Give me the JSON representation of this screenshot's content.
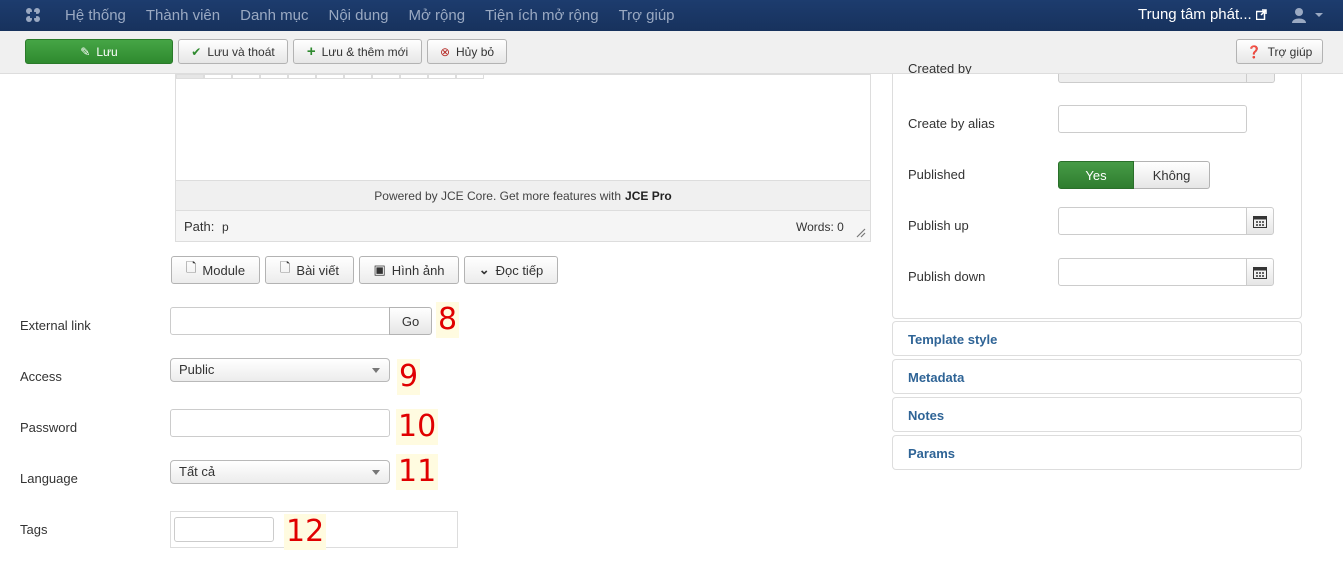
{
  "navbar": {
    "menu": [
      "Hệ thống",
      "Thành viên",
      "Danh mục",
      "Nội dung",
      "Mở rộng",
      "Tiện ích mở rộng",
      "Trợ giúp"
    ],
    "site_label": "Trung tâm phát...",
    "brand_icon": "joomla-logo-icon",
    "user_icon": "user-icon"
  },
  "toolbar": {
    "save": "Lưu",
    "save_close": "Lưu và thoát",
    "save_new": "Lưu & thêm mới",
    "cancel": "Hủy bỏ",
    "help": "Trợ giúp"
  },
  "editor": {
    "powered_prefix": "Powered by JCE Core. Get more features with",
    "powered_brand": "JCE Pro",
    "path_label": "Path:",
    "path_value": "p",
    "words": "Words: 0"
  },
  "insert_buttons": {
    "module": "Module",
    "article": "Bài viết",
    "image": "Hình ảnh",
    "readmore": "Đọc tiếp"
  },
  "form": {
    "external_link": {
      "label": "External link",
      "value": "",
      "go": "Go",
      "marker": "8"
    },
    "access": {
      "label": "Access",
      "value": "Public",
      "marker": "9"
    },
    "password": {
      "label": "Password",
      "value": "",
      "marker": "10"
    },
    "language": {
      "label": "Language",
      "value": "Tất cả",
      "marker": "11"
    },
    "tags": {
      "label": "Tags",
      "value": "",
      "marker": "12"
    }
  },
  "right_panel": {
    "created_by": "Created by",
    "created_by_alias": "Create by alias",
    "published": "Published",
    "published_yes": "Yes",
    "published_no": "Không",
    "publish_up": "Publish up",
    "publish_down": "Publish down"
  },
  "accordion": [
    "Template style",
    "Metadata",
    "Notes",
    "Params"
  ],
  "colors": {
    "navbar": "#1d3c6e",
    "save_green": "#2f8a2f",
    "accordion_link": "#2f6496",
    "marker_red": "#e00000",
    "marker_bg": "#fffbe0"
  }
}
